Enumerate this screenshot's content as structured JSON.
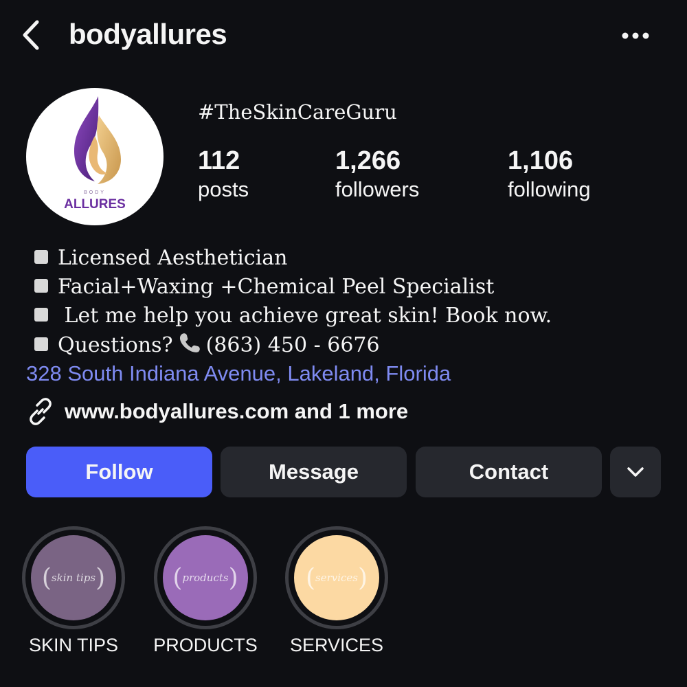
{
  "header": {
    "username": "bodyallures",
    "back_icon": "chevron-left-icon",
    "more_icon": "more-horizontal-icon"
  },
  "profile": {
    "avatar": {
      "brand_small": "BODY",
      "brand_name": "ALLURES"
    },
    "tagline": "#TheSkinCareGuru",
    "stats": [
      {
        "value": "112",
        "label": "posts"
      },
      {
        "value": "1,266",
        "label": "followers"
      },
      {
        "value": "1,106",
        "label": "following"
      }
    ]
  },
  "bio": {
    "lines": [
      "Licensed Aesthetician",
      "Facial+Waxing +Chemical Peel Specialist",
      " Let me help you achieve great skin! Book now.",
      "Questions?"
    ],
    "phone": "(863) 450 - 6676",
    "address": "328 South Indiana Avenue, Lakeland, Florida",
    "link": "www.bodyallures.com and 1 more"
  },
  "actions": {
    "follow": "Follow",
    "message": "Message",
    "contact": "Contact"
  },
  "highlights": [
    {
      "label": "SKIN TIPS",
      "cover_text": "skin tips",
      "color": "#7a6484"
    },
    {
      "label": "PRODUCTS",
      "cover_text": "products",
      "color": "#9a6bb8"
    },
    {
      "label": "SERVICES",
      "cover_text": "services",
      "color": "#fcd9a3"
    }
  ],
  "colors": {
    "background": "#0e0f13",
    "accent": "#4a5df9",
    "link": "#7f8bf2",
    "button": "#26282e"
  }
}
